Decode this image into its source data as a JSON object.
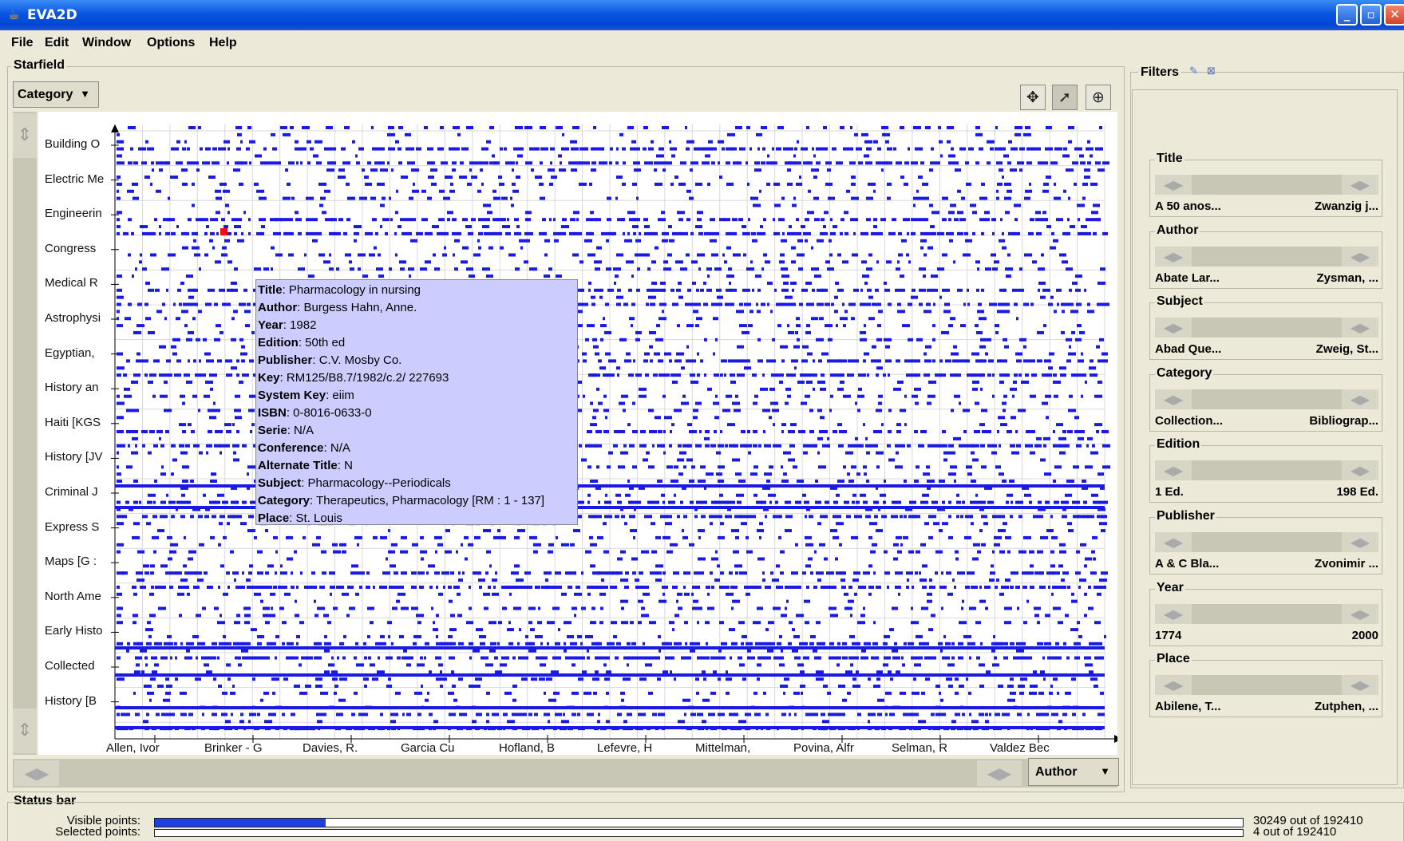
{
  "window": {
    "title": "EVA2D",
    "minimize": "_",
    "maximize": "▫",
    "close": "✕"
  },
  "menu": [
    "File",
    "Edit",
    "Window",
    "Options",
    "Help"
  ],
  "starfield": {
    "title": "Starfield",
    "y_dropdown": "Category",
    "x_dropdown": "Author",
    "tools": [
      "move-icon",
      "pointer-icon",
      "zoom-icon"
    ],
    "y_labels": [
      "Building O",
      "Electric Me",
      "Engineerin",
      "Congress",
      "Medical R",
      "Astrophysi",
      "Egyptian,",
      "History an",
      "Haiti  [KGS",
      "History  [JV",
      "Criminal J",
      "Express S",
      "Maps  [G :",
      "North Ame",
      "Early Histo",
      "Collected",
      "History  [B"
    ],
    "x_labels": [
      "Allen, Ivor",
      "Brinker - G",
      "Davies, R.",
      "Garcia Cu",
      "Hofland, B",
      "Lefevre, H",
      "Mittelman,",
      "Povina, Alfr",
      "Selman, R",
      "Valdez Bec"
    ],
    "point_color": "#1a1ae6",
    "selected_color": "#ee1111"
  },
  "tooltip": [
    {
      "k": "Title",
      "v": ": Pharmacology in nursing"
    },
    {
      "k": "Author",
      "v": ": Burgess Hahn, Anne."
    },
    {
      "k": "Year",
      "v": ": 1982"
    },
    {
      "k": "Edition",
      "v": ": 50th ed"
    },
    {
      "k": "Publisher",
      "v": ": C.V. Mosby Co."
    },
    {
      "k": "Key",
      "v": ": RM125/B8.7/1982/c.2/ 227693"
    },
    {
      "k": "System Key",
      "v": ": eiim"
    },
    {
      "k": "ISBN",
      "v": ": 0-8016-0633-0"
    },
    {
      "k": "Serie",
      "v": ": N/A"
    },
    {
      "k": "Conference",
      "v": ": N/A"
    },
    {
      "k": "Alternate Title",
      "v": ": N"
    },
    {
      "k": "Subject",
      "v": ": Pharmacology--Periodicals"
    },
    {
      "k": "Category",
      "v": ": Therapeutics, Pharmacology [RM : 1 - 137]"
    },
    {
      "k": "Place",
      "v": ": St. Louis"
    }
  ],
  "filters": {
    "title": "Filters",
    "items": [
      {
        "name": "Title",
        "min": "A 50 anos...",
        "max": "Zwanzig j..."
      },
      {
        "name": "Author",
        "min": "Abate Lar...",
        "max": "Zysman, ..."
      },
      {
        "name": "Subject",
        "min": "Abad Que...",
        "max": "Zweig, St..."
      },
      {
        "name": "Category",
        "min": "Collection...",
        "max": "Bibliograp..."
      },
      {
        "name": "Edition",
        "min": "1 Ed.",
        "max": "198 Ed."
      },
      {
        "name": "Publisher",
        "min": "A & C Bla...",
        "max": "Zvonimir ..."
      },
      {
        "name": "Year",
        "min": "1774",
        "max": "2000"
      },
      {
        "name": "Place",
        "min": "Abilene, T...",
        "max": "Zutphen, ..."
      }
    ]
  },
  "status": {
    "title": "Status bar",
    "visible_label": "Visible points:",
    "selected_label": "Selected points:",
    "visible_count": "30249 out of 192410",
    "selected_count": "4 out of 192410",
    "visible_fraction": 0.157,
    "selected_fraction": 2e-05
  }
}
